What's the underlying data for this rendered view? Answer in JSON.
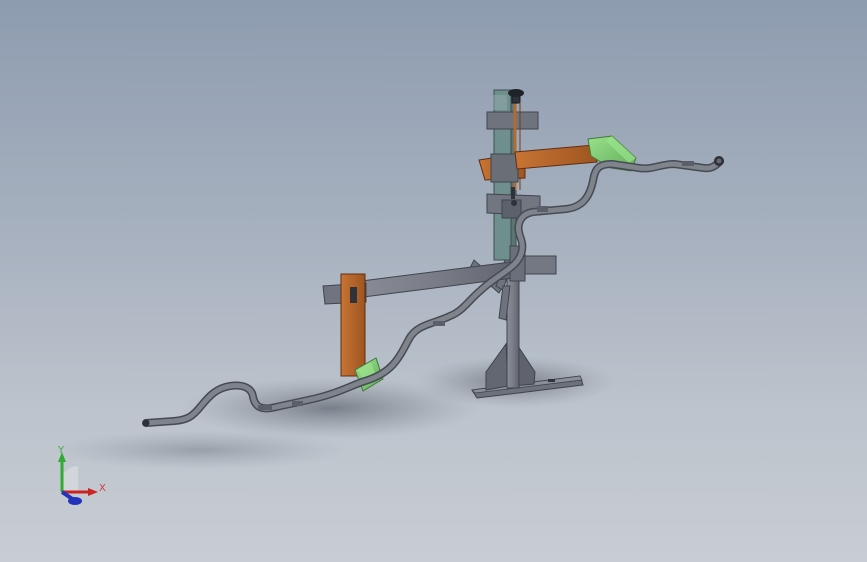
{
  "viewport": {
    "background_top": "#8e9cb0",
    "background_bottom": "#c8cdd3",
    "scene": "3d-cad-assembly-isometric-view"
  },
  "model": {
    "colors": {
      "frame": "#7a7d87",
      "frame_dark": "#5d616c",
      "clamp_orange": "#b56328",
      "clamp_green": "#79c96f",
      "pipe": "#777b83"
    }
  },
  "triad": {
    "y_label": "Y",
    "x_label": "X",
    "colors": {
      "y": "#33aa33",
      "x": "#cc2222",
      "z": "#2233bb"
    }
  }
}
